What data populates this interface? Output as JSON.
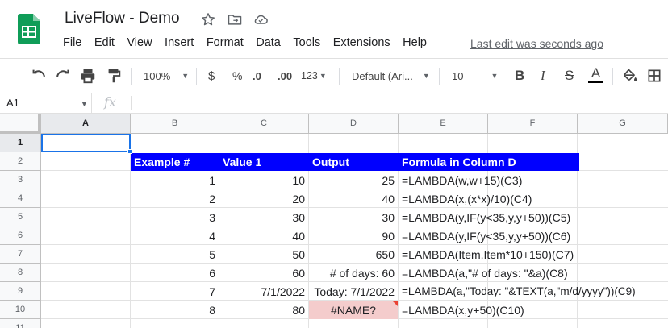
{
  "app": {
    "title": "LiveFlow - Demo",
    "menu": [
      "File",
      "Edit",
      "View",
      "Insert",
      "Format",
      "Data",
      "Tools",
      "Extensions",
      "Help"
    ],
    "last_edit": "Last edit was seconds ago",
    "title_icons": [
      "star-icon",
      "move-to-folder-icon",
      "cloud-saved-icon"
    ]
  },
  "toolbar": {
    "zoom": "100%",
    "currency": "$",
    "percent": "%",
    "dec_decrease": ".0",
    "dec_increase": ".00",
    "more_formats": "123",
    "font": "Default (Ari...",
    "font_size": "10",
    "bold": "B",
    "italic": "I",
    "strike": "S",
    "text_color": "A",
    "text_color_value": "#000000"
  },
  "formula_bar": {
    "name_box": "A1",
    "fx": "fx",
    "value": ""
  },
  "grid": {
    "columns": [
      "A",
      "B",
      "C",
      "D",
      "E",
      "F",
      "G"
    ],
    "rows": [
      "1",
      "2",
      "3",
      "4",
      "5",
      "6",
      "7",
      "8",
      "9",
      "10",
      "11"
    ],
    "selected_cell": "A1",
    "header_fill": "#0000ff",
    "header_text_color": "#ffffff",
    "error_fill": "#f4cccc",
    "headers": [
      "Example #",
      "Value 1",
      "Output",
      "Formula in Column D"
    ],
    "data": [
      {
        "example": "1",
        "value1": "10",
        "output": "25",
        "formula": "=LAMBDA(w,w+15)(C3)"
      },
      {
        "example": "2",
        "value1": "20",
        "output": "40",
        "formula": "=LAMBDA(x,(x*x)/10)(C4)"
      },
      {
        "example": "3",
        "value1": "30",
        "output": "30",
        "formula": "=LAMBDA(y,IF(y<35,y,y+50))(C5)"
      },
      {
        "example": "4",
        "value1": "40",
        "output": "90",
        "formula": "=LAMBDA(y,IF(y<35,y,y+50))(C6)"
      },
      {
        "example": "5",
        "value1": "50",
        "output": "650",
        "formula": "=LAMBDA(Item,Item*10+150)(C7)"
      },
      {
        "example": "6",
        "value1": "60",
        "output": "# of days: 60",
        "formula": "=LAMBDA(a,\"# of days: \"&a)(C8)"
      },
      {
        "example": "7",
        "value1": "7/1/2022",
        "output": "Today: 7/1/2022",
        "formula": "=LAMBDA(a,\"Today: \"&TEXT(a,\"m/d/yyyy\"))(C9)"
      },
      {
        "example": "8",
        "value1": "80",
        "output": "#NAME?",
        "formula": "=LAMBDA(x,y+50)(C10)"
      }
    ]
  }
}
